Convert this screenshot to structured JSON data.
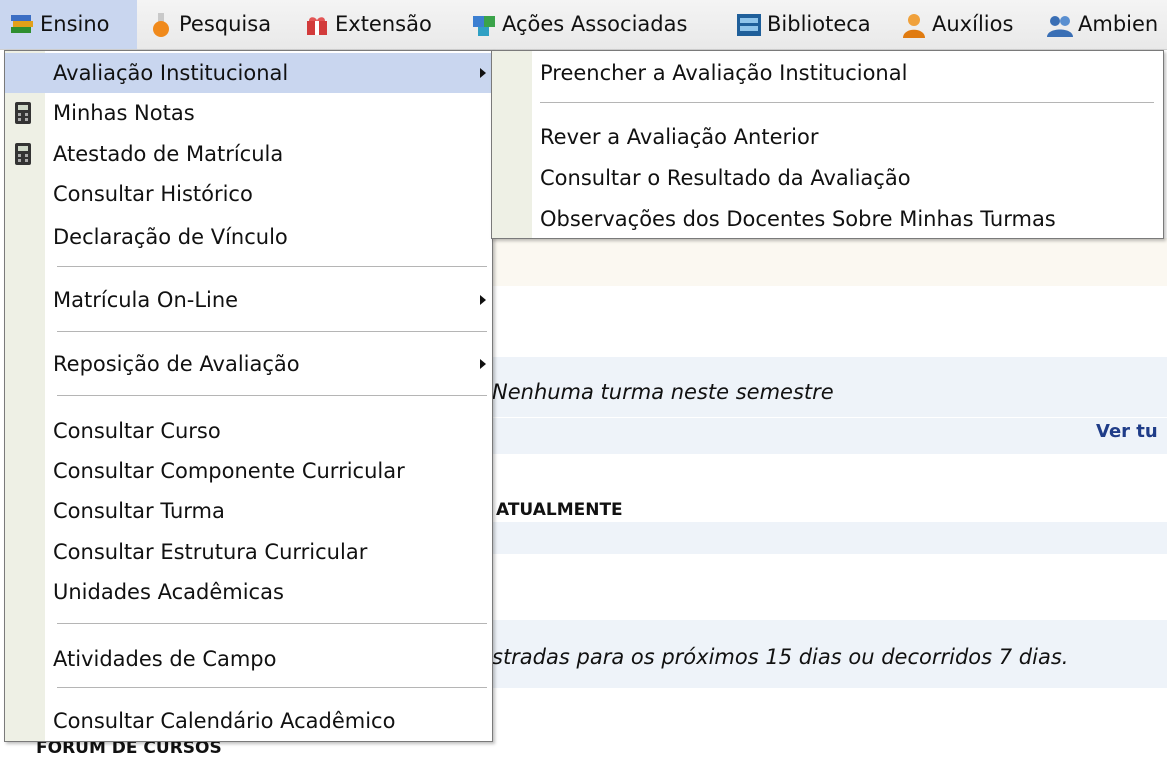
{
  "menubar": {
    "items": [
      {
        "label": "Ensino",
        "icon": "books-icon"
      },
      {
        "label": "Pesquisa",
        "icon": "flask-icon"
      },
      {
        "label": "Extensão",
        "icon": "gift-icon"
      },
      {
        "label": "Ações Associadas",
        "icon": "puzzle-icon"
      },
      {
        "label": "Biblioteca",
        "icon": "bookshelf-icon"
      },
      {
        "label": "Auxílios",
        "icon": "person-icon"
      },
      {
        "label": "Ambien",
        "icon": "people-icon"
      }
    ]
  },
  "ensino_menu": {
    "items": [
      {
        "label": "Avaliação Institucional",
        "has_submenu": true
      },
      {
        "label": "Minhas Notas",
        "icon": "calculator-icon"
      },
      {
        "label": "Atestado de Matrícula",
        "icon": "calculator-icon"
      },
      {
        "label": "Consultar Histórico"
      },
      {
        "label": "Declaração de Vínculo"
      },
      {
        "label": "Matrícula On-Line",
        "has_submenu": true
      },
      {
        "label": "Reposição de Avaliação",
        "has_submenu": true
      },
      {
        "label": "Consultar Curso"
      },
      {
        "label": "Consultar Componente Curricular"
      },
      {
        "label": "Consultar Turma"
      },
      {
        "label": "Consultar Estrutura Curricular"
      },
      {
        "label": "Unidades Acadêmicas"
      },
      {
        "label": "Atividades de Campo"
      },
      {
        "label": "Consultar Calendário Acadêmico"
      }
    ]
  },
  "avaliacao_submenu": {
    "items": [
      {
        "label": "Preencher a Avaliação Institucional"
      },
      {
        "label": "Rever a Avaliação Anterior"
      },
      {
        "label": "Consultar o Resultado da Avaliação"
      },
      {
        "label": "Observações dos Docentes Sobre Minhas Turmas"
      }
    ]
  },
  "background": {
    "no_class_text": "Nenhuma turma neste semestre",
    "see_all_link": "Ver tu",
    "currently_header": "ATUALMENTE",
    "dates_notice": "stradas para os próximos 15 dias ou decorridos 7 dias.",
    "forum_header": "FÓRUM DE CURSOS"
  },
  "colors": {
    "highlight": "#c9d6ef",
    "gutter": "#eef0e5",
    "band_light": "#eef3f9",
    "link": "#1f3c88"
  }
}
